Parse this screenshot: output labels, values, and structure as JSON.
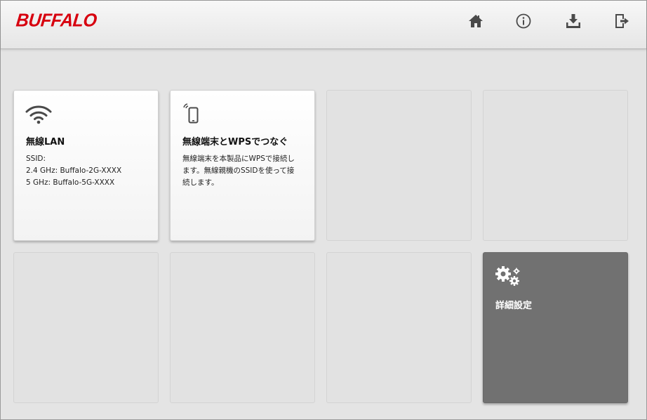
{
  "header": {
    "logo": "BUFFALO",
    "icons": [
      "home-icon",
      "info-icon",
      "download-icon",
      "logout-icon"
    ]
  },
  "tiles": [
    {
      "icon": "wifi-icon",
      "title": "無線LAN",
      "lines": [
        "SSID:",
        "2.4 GHz: Buffalo-2G-XXXX",
        "5 GHz: Buffalo-5G-XXXX"
      ]
    },
    {
      "icon": "smartphone-wireless-icon",
      "title": "無線端末とWPSでつなぐ",
      "lines": [
        "無線端末を本製品にWPSで接続し",
        "ます。無線親機のSSIDを使って接",
        "続します。"
      ]
    },
    {
      "icon": "gears-icon",
      "title": "詳細設定"
    }
  ],
  "colors": {
    "brand": "#d7000f",
    "background": "#e4e4e4",
    "dark_tile": "#717171"
  }
}
